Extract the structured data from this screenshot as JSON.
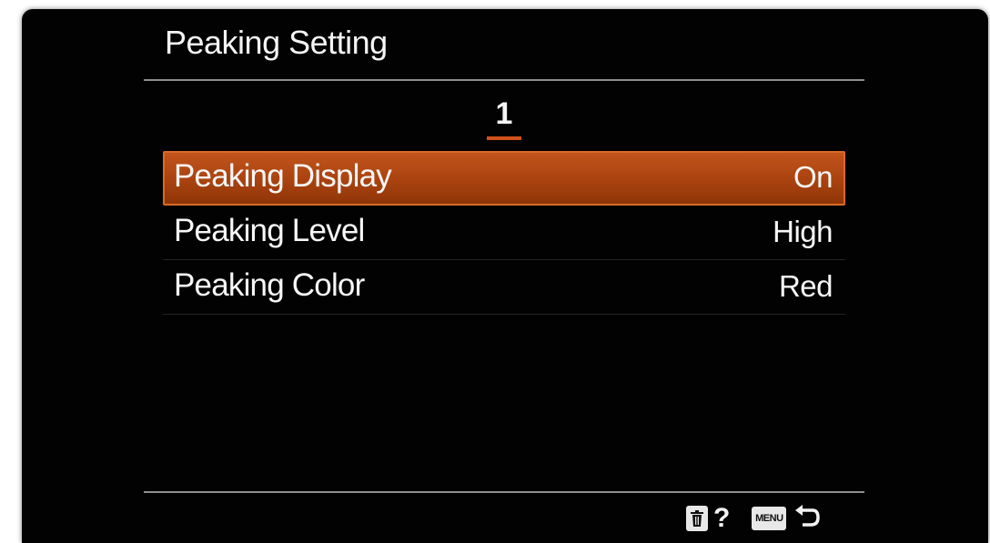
{
  "header": {
    "title": "Peaking Setting",
    "page_number": "1"
  },
  "menu": {
    "items": [
      {
        "label": "Peaking Display",
        "value": "On",
        "selected": true
      },
      {
        "label": "Peaking Level",
        "value": "High",
        "selected": false
      },
      {
        "label": "Peaking Color",
        "value": "Red",
        "selected": false
      }
    ]
  },
  "footer": {
    "trash_icon": "trash-icon",
    "help_label": "?",
    "menu_key_label": "MENU",
    "back_icon": "return-arrow-icon"
  },
  "colors": {
    "background": "#020202",
    "selection": "#b04a14",
    "page_indicator": "#d2521a",
    "text": "#f4f4f4"
  }
}
